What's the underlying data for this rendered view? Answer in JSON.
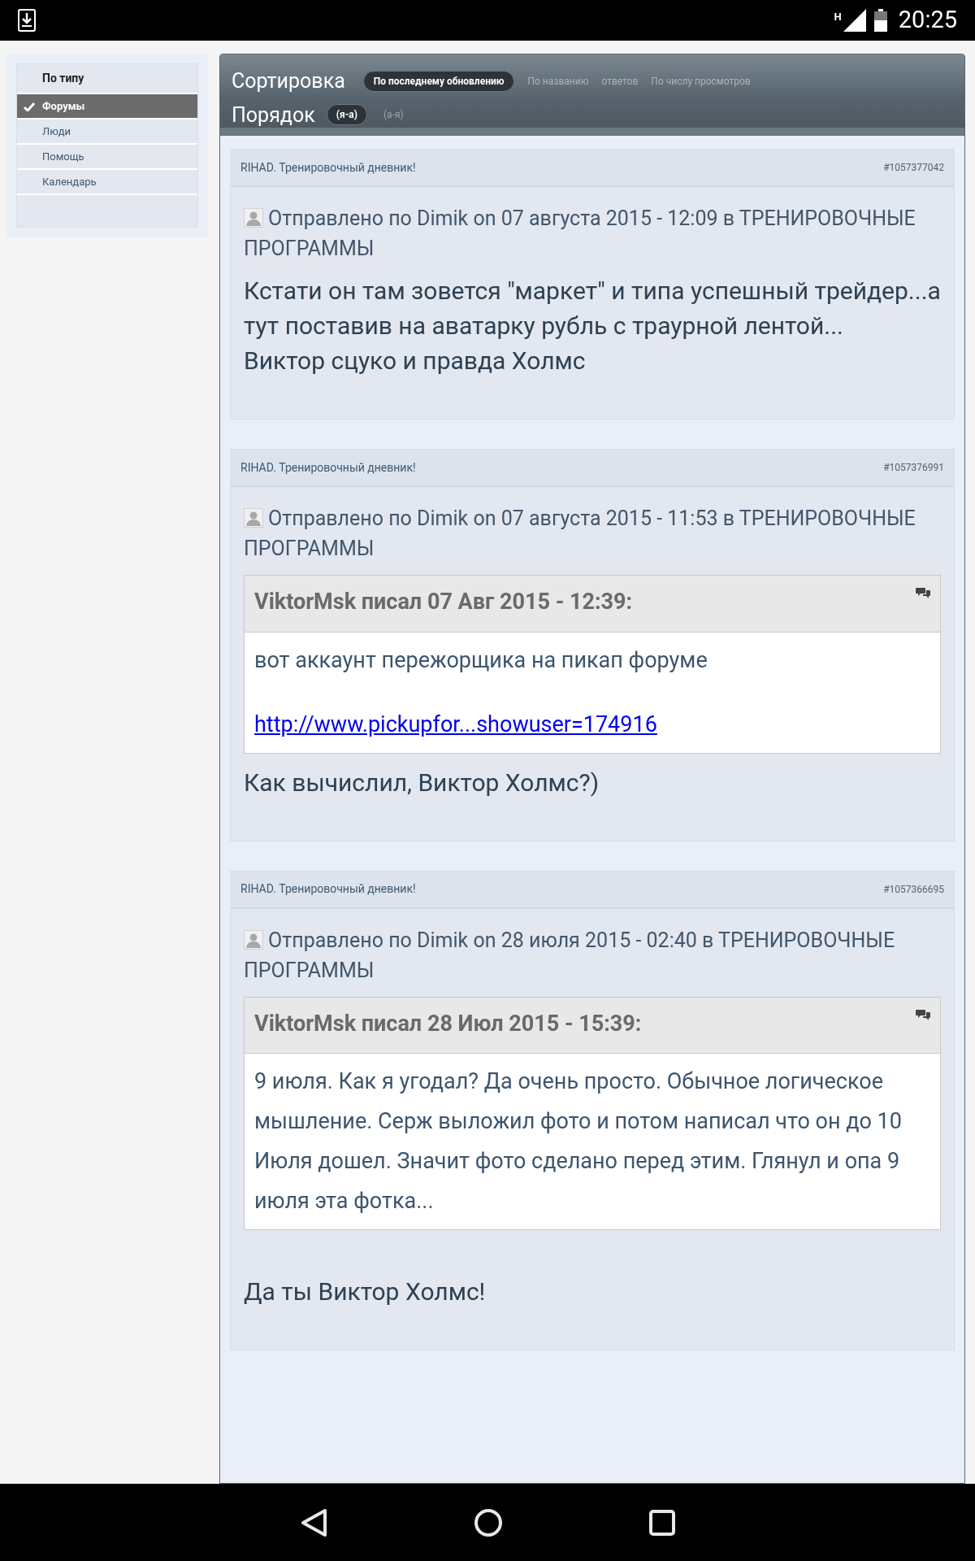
{
  "status_bar": {
    "network": "H",
    "time": "20:25"
  },
  "sidebar": {
    "title": "По типу",
    "items": [
      {
        "label": "Форумы",
        "selected": true
      },
      {
        "label": "Люди",
        "selected": false
      },
      {
        "label": "Помощь",
        "selected": false
      },
      {
        "label": "Календарь",
        "selected": false
      }
    ]
  },
  "sort": {
    "label": "Сортировка",
    "options": [
      {
        "label": "По последнему обновлению",
        "selected": true
      },
      {
        "label": "По названию",
        "selected": false
      },
      {
        "label": "ответов",
        "selected": false
      },
      {
        "label": "По числу просмотров",
        "selected": false
      }
    ]
  },
  "order": {
    "label": "Порядок",
    "options": [
      {
        "label": "(я-а)",
        "selected": true
      },
      {
        "label": "(а-я)",
        "selected": false
      }
    ]
  },
  "posts": [
    {
      "topic": "RIHAD. Тренировочный дневник!",
      "id": "#1057377042",
      "meta": "Отправлено по Dimik on 07 августа 2015 - 12:09 в ТРЕНИРОВОЧНЫЕ ПРОГРАММЫ",
      "blocks": [
        {
          "kind": "text",
          "text": "Кстати он там зовется \"маркет\" и типа успешный трейдер...а тут поставив на аватарку рубль с траурной лентой..."
        },
        {
          "kind": "text",
          "text": "Виктор сцуко и правда Холмс"
        }
      ]
    },
    {
      "topic": "RIHAD. Тренировочный дневник!",
      "id": "#1057376991",
      "meta": "Отправлено по Dimik on 07 августа 2015 - 11:53 в ТРЕНИРОВОЧНЫЕ ПРОГРАММЫ",
      "blocks": [
        {
          "kind": "quote",
          "author": "ViktorMsk писал 07 Авг 2015 - 12:39:",
          "text": "вот аккаунт пережорщика на пикап форуме",
          "link": "http://www.pickupfor...showuser=174916"
        },
        {
          "kind": "text",
          "text": "Как вычислил, Виктор Холмс?)"
        }
      ]
    },
    {
      "topic": "RIHAD. Тренировочный дневник!",
      "id": "#1057366695",
      "meta": "Отправлено по Dimik on 28 июля 2015 - 02:40 в ТРЕНИРОВОЧНЫЕ ПРОГРАММЫ",
      "blocks": [
        {
          "kind": "quote",
          "author": "ViktorMsk писал 28 Июл 2015 - 15:39:",
          "text": "9 июля. Как я угодал? Да очень просто. Обычное логическое мышление. Серж выложил фото и потом написал что он до 10 Июля дошел. Значит фото сделано перед этим. Глянул и опа 9 июля эта фотка..."
        },
        {
          "kind": "spacer"
        },
        {
          "kind": "text",
          "text": "Да ты Виктор Холмс!"
        }
      ]
    }
  ]
}
